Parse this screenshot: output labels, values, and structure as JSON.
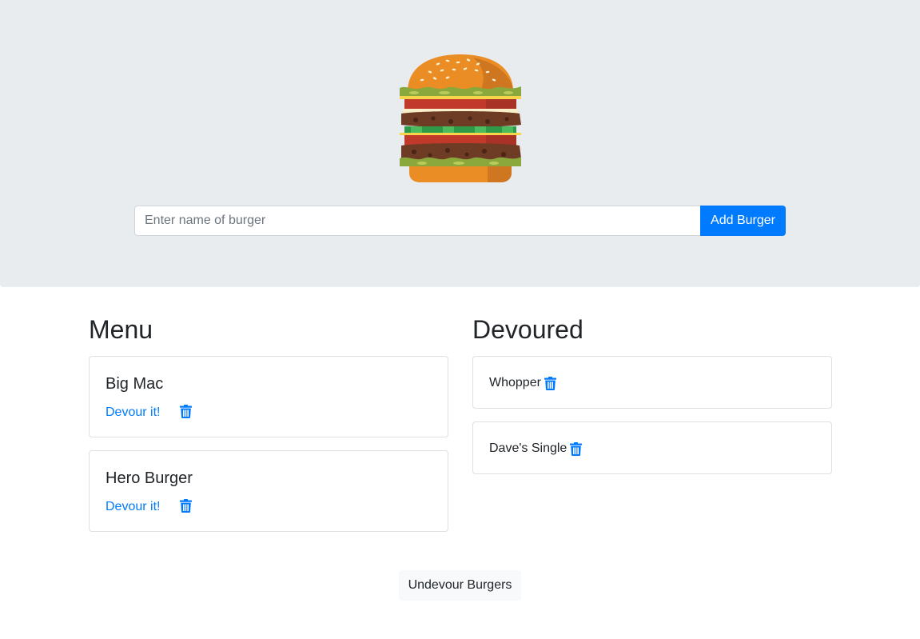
{
  "header": {
    "logo_icon": "burger-icon",
    "input_placeholder": "Enter name of burger",
    "input_value": "",
    "add_button_label": "Add Burger"
  },
  "menu": {
    "title": "Menu",
    "items": [
      {
        "name": "Big Mac",
        "devour_label": "Devour it!",
        "delete_icon": "trash-icon"
      },
      {
        "name": "Hero Burger",
        "devour_label": "Devour it!",
        "delete_icon": "trash-icon"
      }
    ]
  },
  "devoured": {
    "title": "Devoured",
    "items": [
      {
        "name": "Whopper",
        "delete_icon": "trash-icon"
      },
      {
        "name": "Dave's Single",
        "delete_icon": "trash-icon"
      }
    ]
  },
  "footer": {
    "undevour_label": "Undevour Burgers"
  },
  "colors": {
    "jumbotron_bg": "#e9ecef",
    "primary": "#007bff",
    "light_button": "#f8f9fa",
    "text": "#212529"
  }
}
